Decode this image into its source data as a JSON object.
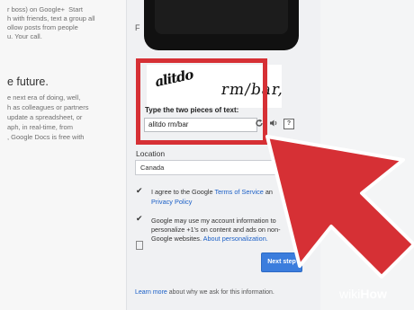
{
  "left_column": {
    "lines_top": [
      "r boss) on Google+  Start",
      "h with friends, text a group all",
      "ollow posts from people",
      "u. Your call."
    ],
    "heading": "e future.",
    "lines_bottom": [
      "e next era of doing, well,",
      "h as colleagues or partners",
      "update a spreadsheet, or",
      "aph, in real-time, from",
      ", Google Docs is free with"
    ]
  },
  "panel_letter": "F",
  "captcha": {
    "word1": "alitdo",
    "word2": "rm/bar,",
    "label": "Type the two pieces of text:",
    "input_value": "alitdo rm/bar",
    "icons": [
      "refresh-icon",
      "audio-icon",
      "help-icon"
    ],
    "help_glyph": "?"
  },
  "location": {
    "label": "Location",
    "value": "Canada"
  },
  "terms": {
    "agree_prefix": "I agree to the Google ",
    "agree_link1": "Terms of Service",
    "agree_mid": " an",
    "agree_link2": "Privacy Policy",
    "personalize_lines": [
      "Google may use my account information to",
      "personalize +1's on content and ads on non-",
      "Google websites. "
    ],
    "personalize_link": "About personalization."
  },
  "next_button": "Next step",
  "learn_more": {
    "link": "Learn more",
    "text": " about why we ask for this information."
  },
  "watermark": {
    "prefix": "wiki",
    "suffix": "How"
  },
  "colors": {
    "highlight_red": "#d63035",
    "link_blue": "#1a5fc7",
    "button_blue": "#3b7ddd"
  }
}
